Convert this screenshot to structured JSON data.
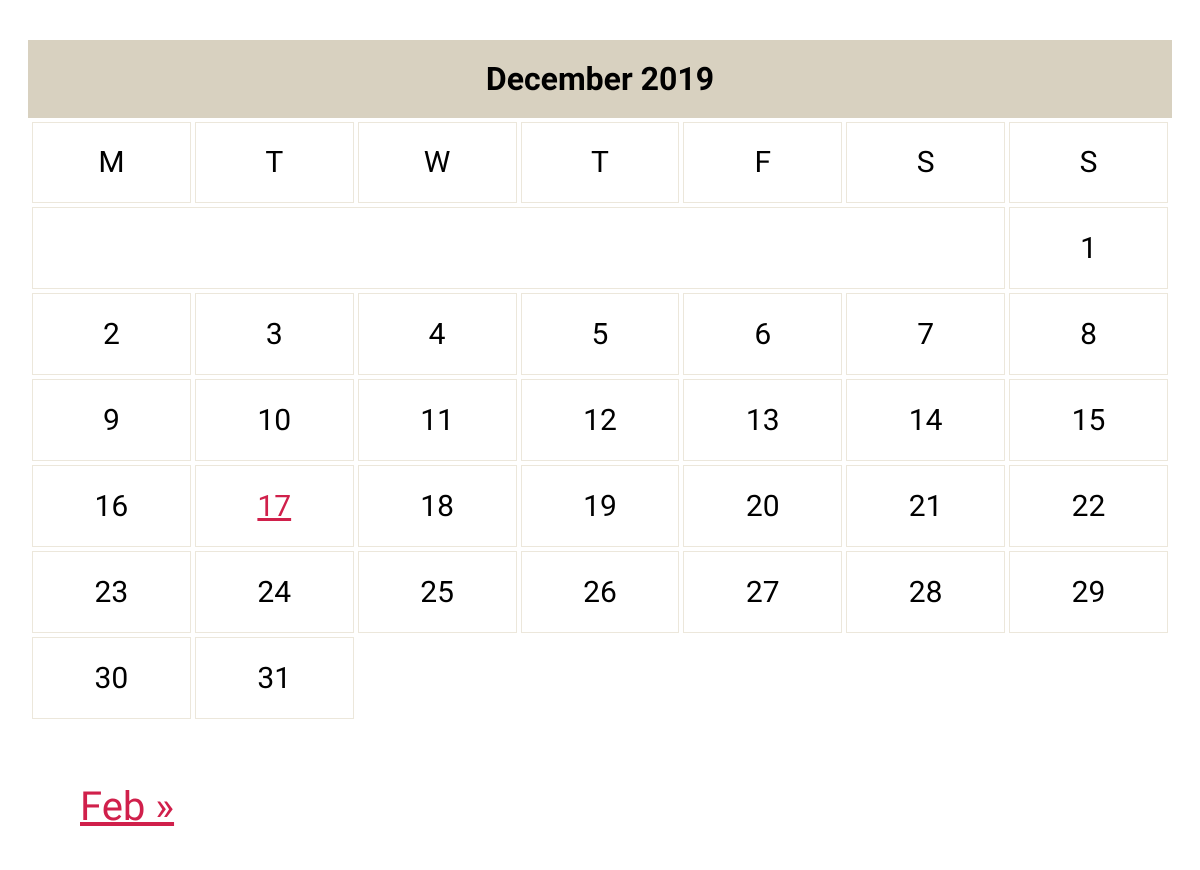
{
  "calendar": {
    "title": "December 2019",
    "weekdays": [
      "M",
      "T",
      "W",
      "T",
      "F",
      "S",
      "S"
    ],
    "weeks": [
      [
        {
          "day": "",
          "link": false,
          "pad": true,
          "colspan": 6
        },
        {
          "day": "1",
          "link": false
        }
      ],
      [
        {
          "day": "2",
          "link": false
        },
        {
          "day": "3",
          "link": false
        },
        {
          "day": "4",
          "link": false
        },
        {
          "day": "5",
          "link": false
        },
        {
          "day": "6",
          "link": false
        },
        {
          "day": "7",
          "link": false
        },
        {
          "day": "8",
          "link": false
        }
      ],
      [
        {
          "day": "9",
          "link": false
        },
        {
          "day": "10",
          "link": false
        },
        {
          "day": "11",
          "link": false
        },
        {
          "day": "12",
          "link": false
        },
        {
          "day": "13",
          "link": false
        },
        {
          "day": "14",
          "link": false
        },
        {
          "day": "15",
          "link": false
        }
      ],
      [
        {
          "day": "16",
          "link": false
        },
        {
          "day": "17",
          "link": true
        },
        {
          "day": "18",
          "link": false
        },
        {
          "day": "19",
          "link": false
        },
        {
          "day": "20",
          "link": false
        },
        {
          "day": "21",
          "link": false
        },
        {
          "day": "22",
          "link": false
        }
      ],
      [
        {
          "day": "23",
          "link": false
        },
        {
          "day": "24",
          "link": false
        },
        {
          "day": "25",
          "link": false
        },
        {
          "day": "26",
          "link": false
        },
        {
          "day": "27",
          "link": false
        },
        {
          "day": "28",
          "link": false
        },
        {
          "day": "29",
          "link": false
        }
      ],
      [
        {
          "day": "30",
          "link": false
        },
        {
          "day": "31",
          "link": false
        },
        {
          "day": "",
          "link": false,
          "trailing": true,
          "colspan": 5
        }
      ]
    ]
  },
  "nav": {
    "next_label": "Feb »"
  }
}
